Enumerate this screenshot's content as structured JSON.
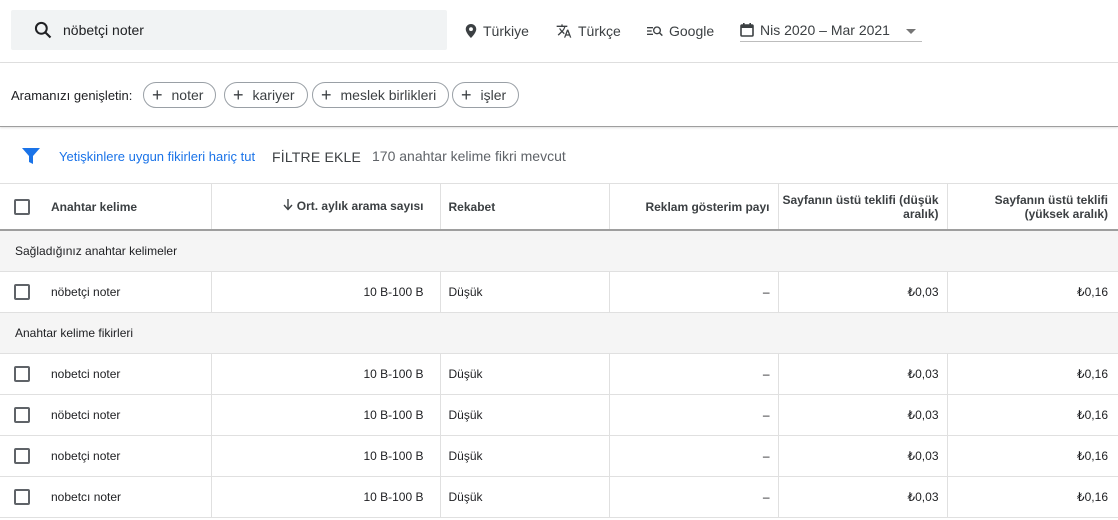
{
  "search": {
    "value": "nöbetçi noter"
  },
  "controls": {
    "location": "Türkiye",
    "language": "Türkçe",
    "network": "Google",
    "date_range": "Nis 2020 – Mar 2021"
  },
  "expand": {
    "label": "Aramanızı genişletin:",
    "chips": [
      "noter",
      "kariyer",
      "meslek birlikleri",
      "işler"
    ]
  },
  "filter": {
    "adult_link": "Yetişkinlere uygun fikirleri hariç tut",
    "add_filter": "FİLTRE EKLE",
    "count": "170 anahtar kelime fikri mevcut"
  },
  "table": {
    "headers": {
      "keyword": "Anahtar kelime",
      "avg_searches": "Ort. aylık arama sayısı",
      "competition": "Rekabet",
      "impression_share": "Reklam gösterim payı",
      "bid_low": "Sayfanın üstü teklifi (düşük aralık)",
      "bid_high": "Sayfanın üstü teklifi (yüksek aralık)"
    },
    "section_provided": "Sağladığınız anahtar kelimeler",
    "provided_rows": [
      {
        "keyword": "nöbetçi noter",
        "searches": "10 B-100 B",
        "competition": "Düşük",
        "share": "–",
        "low": "₺0,03",
        "high": "₺0,16"
      }
    ],
    "section_ideas": "Anahtar kelime fikirleri",
    "idea_rows": [
      {
        "keyword": "nobetci noter",
        "searches": "10 B-100 B",
        "competition": "Düşük",
        "share": "–",
        "low": "₺0,03",
        "high": "₺0,16"
      },
      {
        "keyword": "nöbetci noter",
        "searches": "10 B-100 B",
        "competition": "Düşük",
        "share": "–",
        "low": "₺0,03",
        "high": "₺0,16"
      },
      {
        "keyword": "nobetçi noter",
        "searches": "10 B-100 B",
        "competition": "Düşük",
        "share": "–",
        "low": "₺0,03",
        "high": "₺0,16"
      },
      {
        "keyword": "nobetcı noter",
        "searches": "10 B-100 B",
        "competition": "Düşük",
        "share": "–",
        "low": "₺0,03",
        "high": "₺0,16"
      }
    ]
  },
  "colors": {
    "accent": "#1a73e8",
    "search_bg": "#f1f3f4",
    "section_bg": "#f5f5f5"
  }
}
